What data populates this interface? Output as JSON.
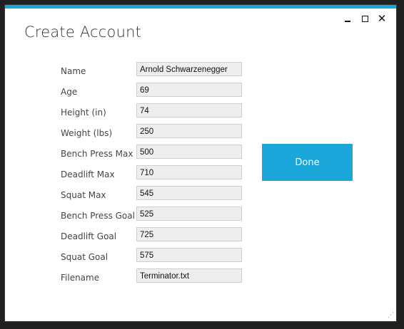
{
  "window": {
    "title": "Create Account",
    "accent_color": "#1aa6d9",
    "controls": {
      "minimize_icon": "minimize-icon",
      "maximize_icon": "maximize-icon",
      "close_icon": "close-icon",
      "close_glyph": "✕"
    }
  },
  "form": {
    "fields": [
      {
        "label": "Name",
        "value": "Arnold Schwarzenegger"
      },
      {
        "label": "Age",
        "value": "69"
      },
      {
        "label": "Height (in)",
        "value": "74"
      },
      {
        "label": "Weight (lbs)",
        "value": "250"
      },
      {
        "label": "Bench Press Max",
        "value": "500"
      },
      {
        "label": "Deadlift Max",
        "value": "710"
      },
      {
        "label": "Squat Max",
        "value": "545"
      },
      {
        "label": "Bench Press Goal",
        "value": "525"
      },
      {
        "label": "Deadlift Goal",
        "value": "725"
      },
      {
        "label": "Squat Goal",
        "value": "575"
      },
      {
        "label": "Filename",
        "value": "Terminator.txt"
      }
    ]
  },
  "actions": {
    "done_label": "Done"
  }
}
